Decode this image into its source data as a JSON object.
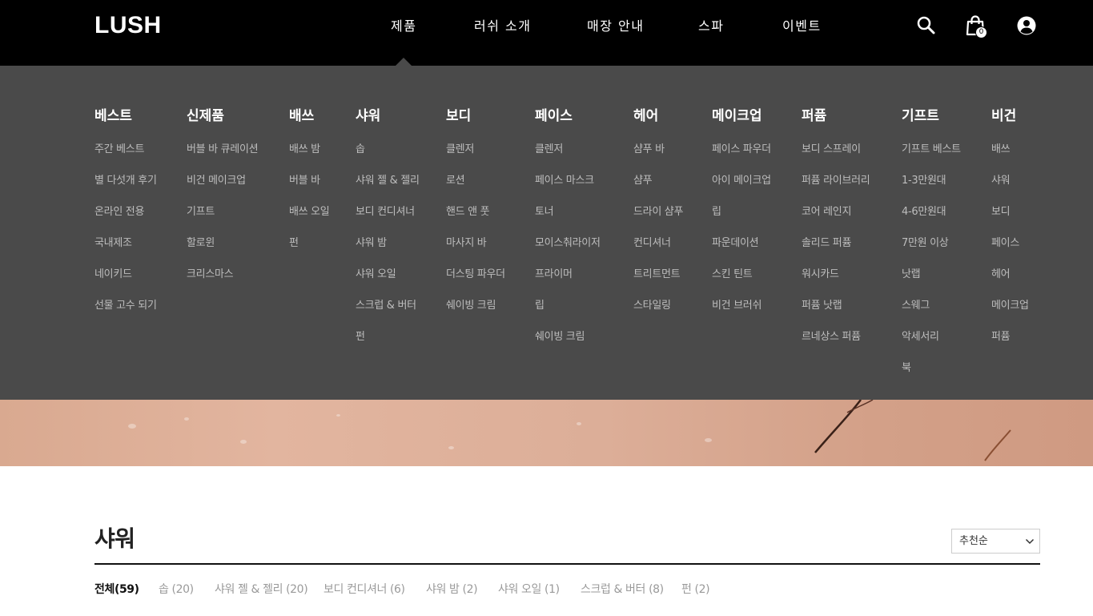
{
  "brand": {
    "logo_text": "LUSH"
  },
  "nav": {
    "items": [
      {
        "label": "제품"
      },
      {
        "label": "러쉬 소개"
      },
      {
        "label": "매장 안내"
      },
      {
        "label": "스파"
      },
      {
        "label": "이벤트"
      }
    ],
    "active": "제품",
    "icons": [
      "search-icon",
      "shopping-bag-icon",
      "account-icon"
    ],
    "cart_count": "0"
  },
  "mega_menu": {
    "columns": [
      {
        "title": "베스트",
        "items": [
          "주간 베스트",
          "별 다섯개 후기",
          "온라인 전용",
          "국내제조",
          "네이키드",
          "선물 고수 되기"
        ]
      },
      {
        "title": "신제품",
        "items": [
          "버블 바 큐레이션",
          "비건 메이크업",
          "기프트",
          "할로윈",
          "크리스마스"
        ]
      },
      {
        "title": "배쓰",
        "items": [
          "배쓰 밤",
          "버블 바",
          "배쓰 오일",
          "펀"
        ]
      },
      {
        "title": "샤워",
        "items": [
          "솝",
          "샤워 젤 & 젤리",
          "보디 컨디셔너",
          "샤워 밤",
          "샤워 오일",
          "스크럽 & 버터",
          "펀"
        ]
      },
      {
        "title": "보디",
        "items": [
          "클렌저",
          "로션",
          "핸드 앤 풋",
          "마사지 바",
          "더스팅 파우더",
          "쉐이빙 크림"
        ]
      },
      {
        "title": "페이스",
        "items": [
          "클렌저",
          "페이스 마스크",
          "토너",
          "모이스춰라이저",
          "프라이머",
          "립",
          "쉐이빙 크림"
        ]
      },
      {
        "title": "헤어",
        "items": [
          "샴푸 바",
          "샴푸",
          "드라이 샴푸",
          "컨디셔너",
          "트리트먼트",
          "스타일링"
        ]
      },
      {
        "title": "메이크업",
        "items": [
          "페이스 파우더",
          "아이 메이크업",
          "립",
          "파운데이션",
          "스킨 틴트",
          "비건 브러쉬"
        ]
      },
      {
        "title": "퍼퓸",
        "items": [
          "보디 스프레이",
          "퍼퓸 라이브러리",
          "코어 레인지",
          "솔리드 퍼퓸",
          "워시카드",
          "퍼퓸 낫랩",
          "르네상스 퍼퓸"
        ]
      },
      {
        "title": "기프트",
        "items": [
          "기프트 베스트",
          "1-3만원대",
          "4-6만원대",
          "7만원 이상",
          "낫랩",
          "스웨그",
          "악세서리",
          "북"
        ]
      },
      {
        "title": "비건",
        "items": [
          "배쓰",
          "샤워",
          "보디",
          "페이스",
          "헤어",
          "메이크업",
          "퍼퓸"
        ]
      }
    ]
  },
  "category": {
    "title": "샤워",
    "sort": {
      "selected": "추천순"
    },
    "filters": [
      {
        "label": "전체(59)",
        "active": true
      },
      {
        "label": "솝 (20)"
      },
      {
        "label": "샤워 젤 & 젤리 (20)"
      },
      {
        "label": "보디 컨디셔너 (6)"
      },
      {
        "label": "샤워 밤 (2)"
      },
      {
        "label": "샤워 오일 (1)"
      },
      {
        "label": "스크럽 & 버터 (8)"
      },
      {
        "label": "펀 (2)"
      }
    ]
  },
  "colors": {
    "topbar": "#000000",
    "mega_menu_bg": "#4a4a4a",
    "mega_title": "#ffffff",
    "mega_item": "#bdbdbd",
    "filter_inactive": "#9a9a9a"
  }
}
